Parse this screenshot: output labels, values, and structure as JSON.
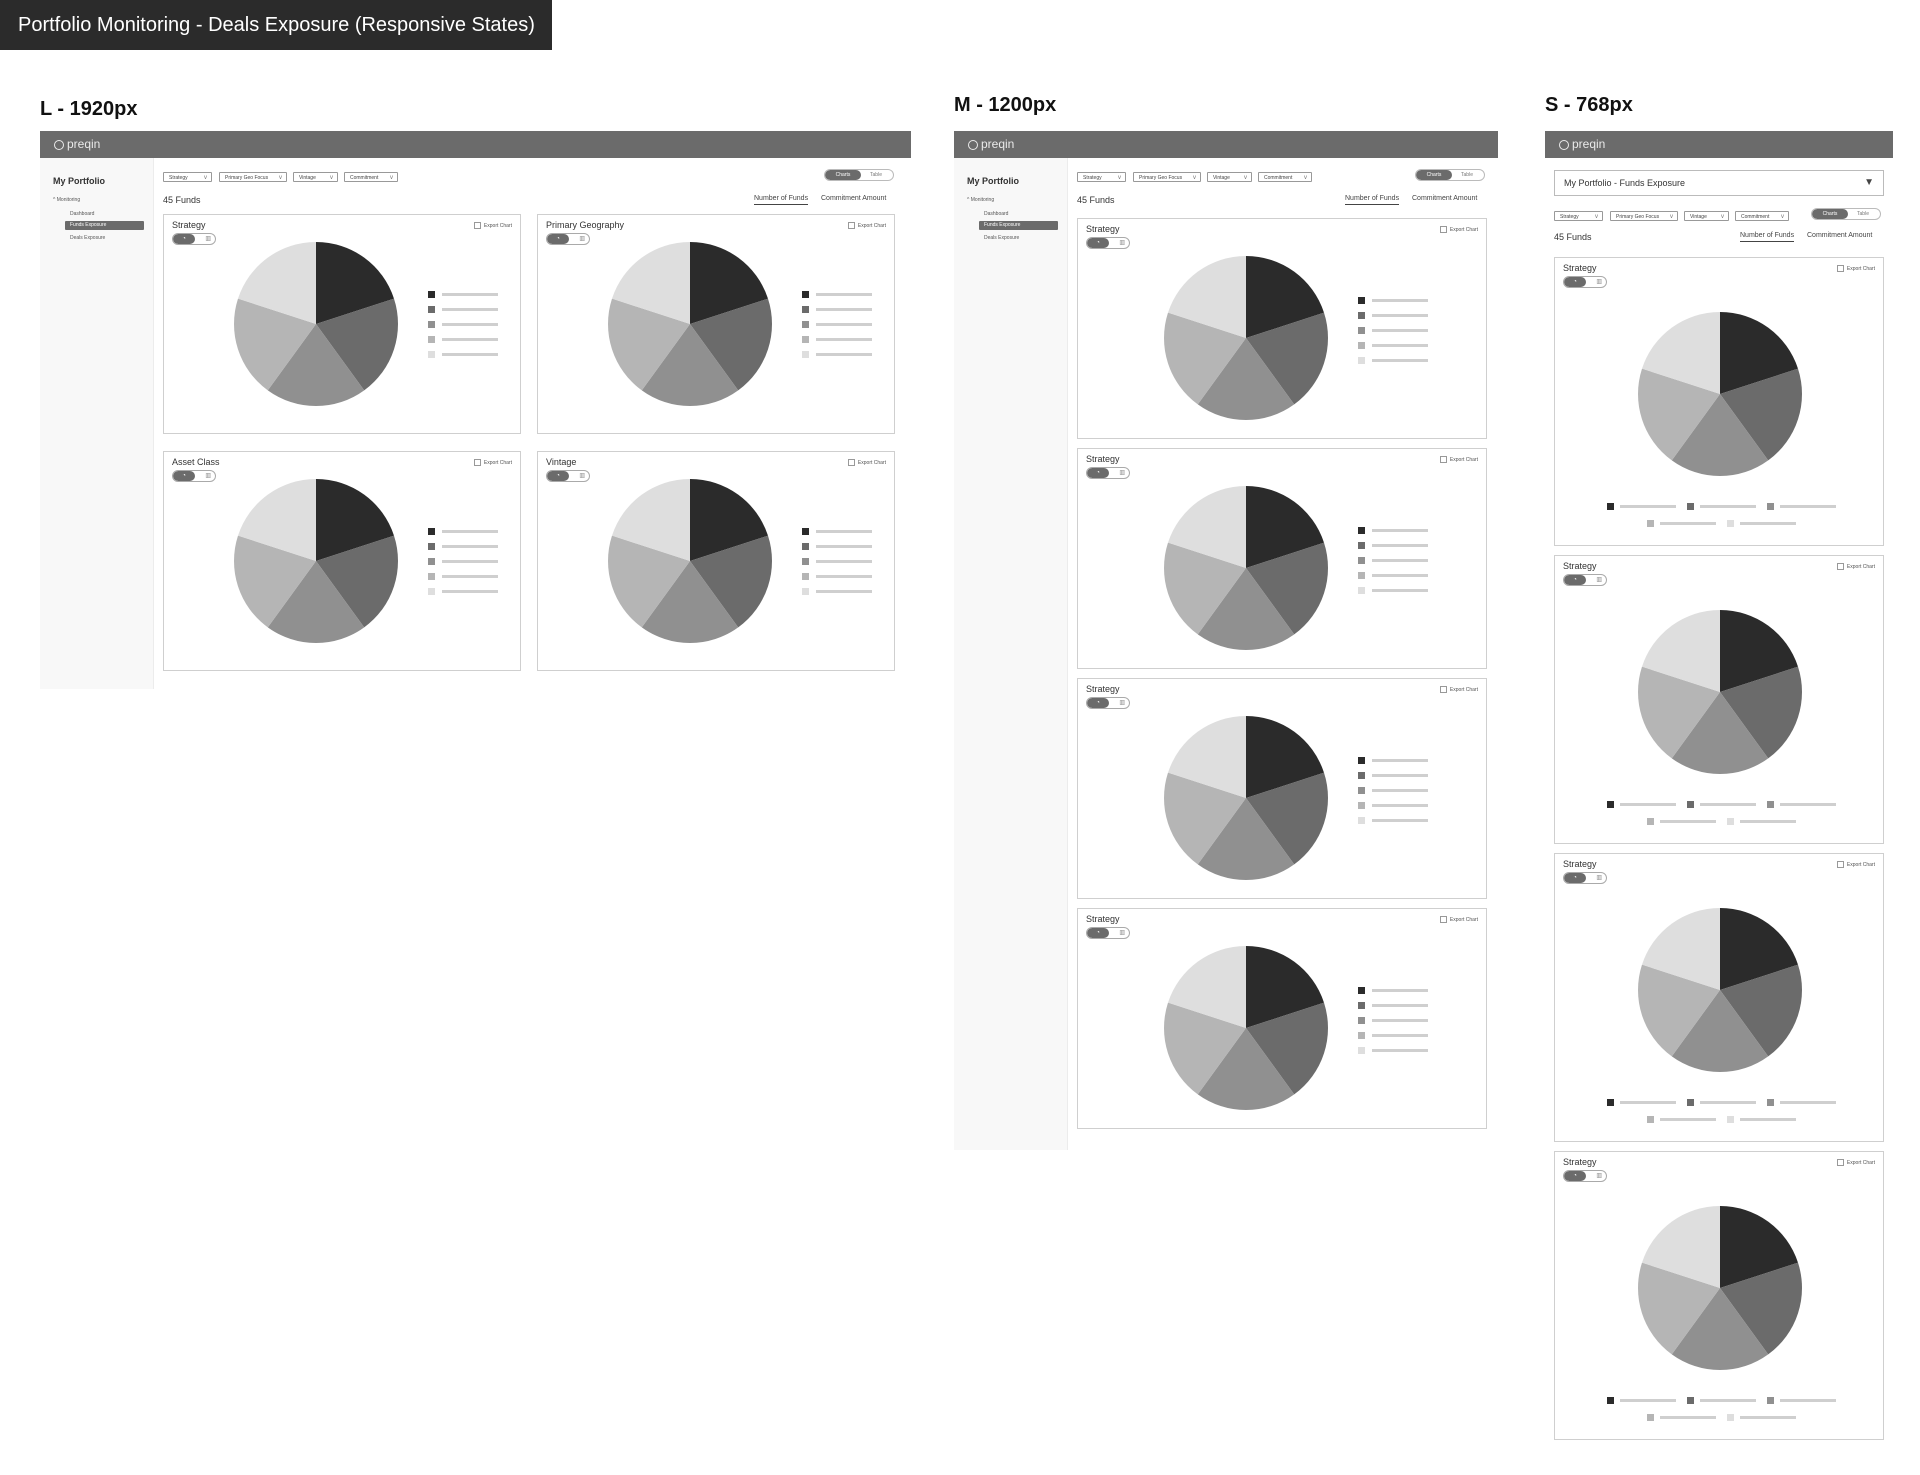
{
  "page_title": "Portfolio Monitoring - Deals Exposure (Responsive States)",
  "states": {
    "l": "L - 1920px",
    "m": "M - 1200px",
    "s": "S - 768px"
  },
  "logo": "preqin",
  "sidebar": {
    "title": "My Portfolio",
    "section": "Monitoring",
    "items": [
      "Dashboard",
      "Funds Exposure",
      "Deals Exposure"
    ]
  },
  "filters": {
    "l": [
      "Strategy",
      "Primary Geo Focus",
      "Vintage",
      "Commitment"
    ],
    "s": [
      "Strategy",
      "Primary Geo Focus",
      "Vintage",
      "Commitment"
    ]
  },
  "view_toggle": {
    "charts": "Charts",
    "table": "Table"
  },
  "funds_count": "45 Funds",
  "tabs": [
    "Number of Funds",
    "Commitment Amount"
  ],
  "export_label": "Export Chart",
  "mobile_dropdown": "My Portfolio - Funds Exposure",
  "cards": {
    "l": [
      "Strategy",
      "Primary Geography",
      "Asset Class",
      "Vintage"
    ],
    "m": [
      "Strategy",
      "Strategy",
      "Strategy",
      "Strategy"
    ],
    "s": [
      "Strategy",
      "Strategy",
      "Strategy",
      "Strategy"
    ]
  },
  "colors": {
    "slices": [
      "#2b2b2b",
      "#6b6b6b",
      "#909090",
      "#b5b5b5",
      "#dedede"
    ],
    "topbar": "#6b6b6b",
    "title_bar": "#2b2b2b"
  },
  "chart_data": {
    "type": "pie",
    "values": [
      20,
      20,
      20,
      20,
      20
    ]
  }
}
